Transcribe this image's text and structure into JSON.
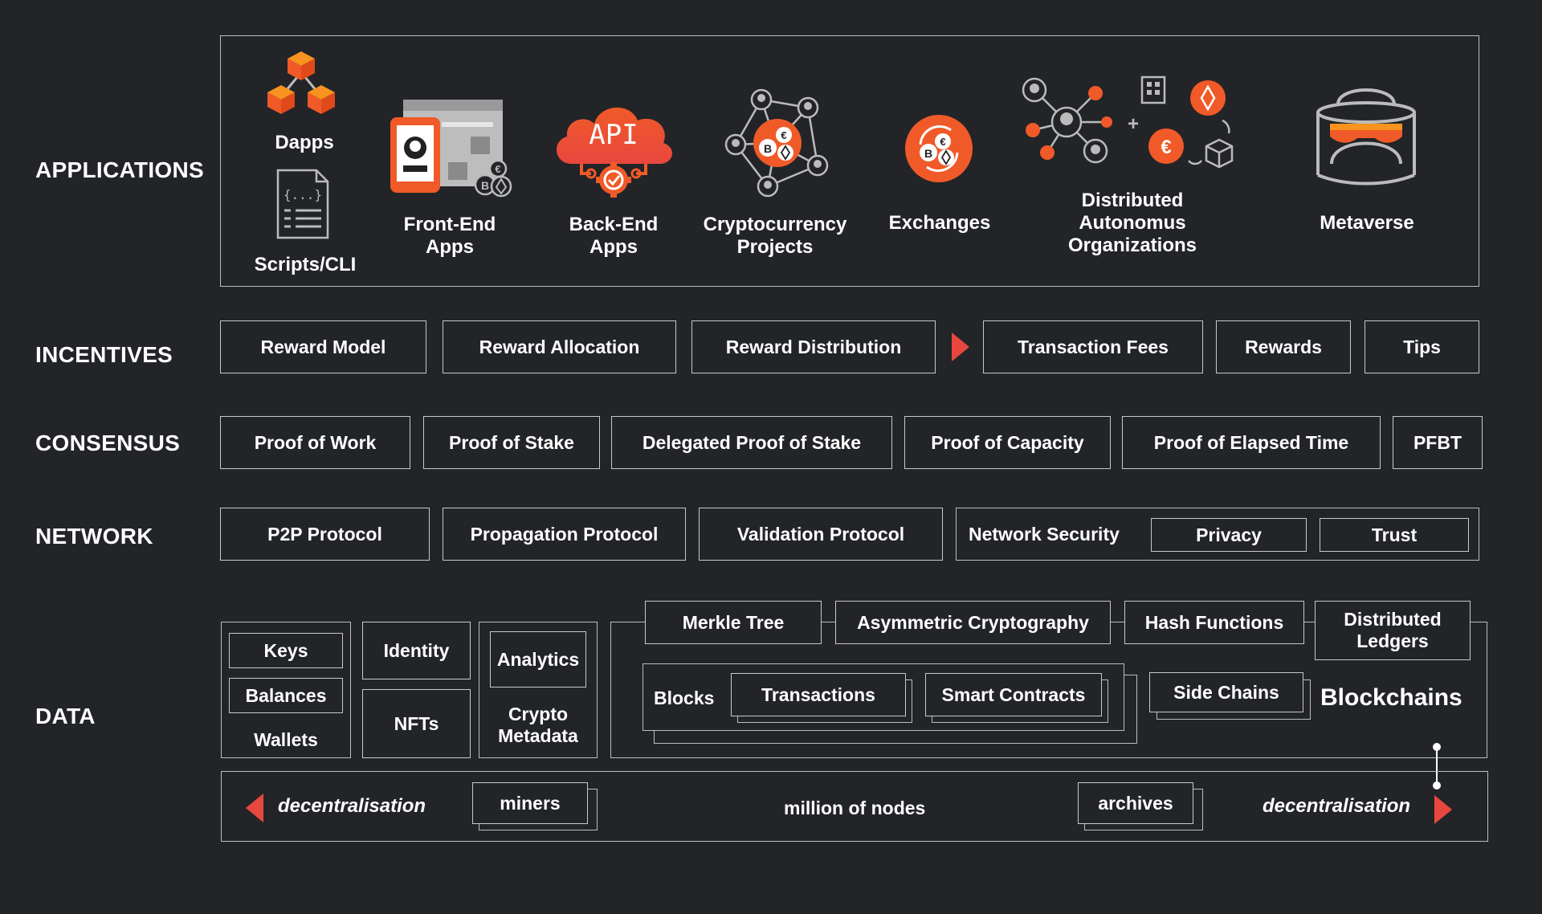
{
  "colors": {
    "background": "#222428",
    "accent": "#f05a28",
    "accent_light": "#f7931e",
    "line": "#c9c9c9",
    "arrow": "#e8473f"
  },
  "rows": {
    "applications": "APPLICATIONS",
    "incentives": "INCENTIVES",
    "consensus": "CONSENSUS",
    "network": "NETWORK",
    "data": "DATA"
  },
  "applications": {
    "dapps": "Dapps",
    "scripts": "Scripts/CLI",
    "frontend": [
      "Front-End",
      "Apps"
    ],
    "backend": [
      "Back-End",
      "Apps"
    ],
    "api_text": "API",
    "crypto": [
      "Cryptocurrency",
      "Projects"
    ],
    "exchanges": "Exchanges",
    "dao": [
      "Distributed",
      "Autonomus",
      "Organizations"
    ],
    "metaverse": "Metaverse"
  },
  "incentives": [
    "Reward Model",
    "Reward Allocation",
    "Reward Distribution",
    "Transaction Fees",
    "Rewards",
    "Tips"
  ],
  "consensus": [
    "Proof of Work",
    "Proof of Stake",
    "Delegated Proof of Stake",
    "Proof of Capacity",
    "Proof of Elapsed Time",
    "PFBT"
  ],
  "network": {
    "items": [
      "P2P Protocol",
      "Propagation Protocol",
      "Validation Protocol"
    ],
    "security": "Network Security",
    "privacy": "Privacy",
    "trust": "Trust"
  },
  "data": {
    "keys": "Keys",
    "balances": "Balances",
    "wallets": "Wallets",
    "identity": "Identity",
    "nfts": "NFTs",
    "analytics": "Analytics",
    "crypto_metadata": [
      "Crypto",
      "Metadata"
    ],
    "merkle": "Merkle Tree",
    "asym": "Asymmetric Cryptography",
    "hash": "Hash Functions",
    "ledgers": [
      "Distributed",
      "Ledgers"
    ],
    "blocks": "Blocks",
    "transactions": "Transactions",
    "smart_contracts": "Smart Contracts",
    "side_chains": "Side Chains",
    "blockchains": "Blockchains"
  },
  "nodes": {
    "decentral_left": "decentralisation",
    "miners": "miners",
    "million": "million of nodes",
    "archives": "archives",
    "decentral_right": "decentralisation"
  }
}
